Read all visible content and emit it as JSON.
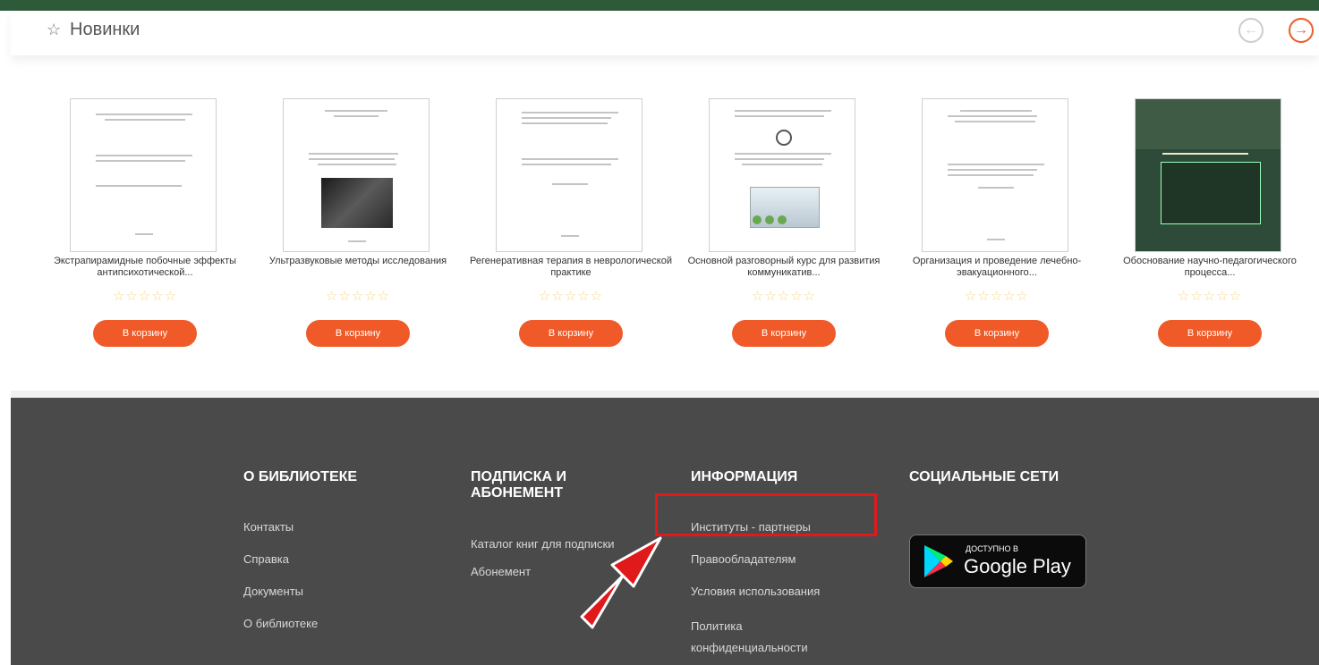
{
  "news": {
    "title": "Новинки",
    "star_icon": "☆",
    "prev_icon": "←",
    "next_icon": "→"
  },
  "books": [
    {
      "title": "Экстрапирамидные побочные эффекты антипсихотической...",
      "stars": "☆☆☆☆☆",
      "cart_label": "В корзину"
    },
    {
      "title": "Ультразвуковые методы исследования",
      "stars": "☆☆☆☆☆",
      "cart_label": "В корзину"
    },
    {
      "title": "Регенеративная терапия в неврологической практике",
      "stars": "☆☆☆☆☆",
      "cart_label": "В корзину"
    },
    {
      "title": "Основной разговорный курс для развития коммуникатив...",
      "stars": "☆☆☆☆☆",
      "cart_label": "В корзину"
    },
    {
      "title": "Организация и проведение лечебно-эвакуационного...",
      "stars": "☆☆☆☆☆",
      "cart_label": "В корзину"
    },
    {
      "title": "Обоснование научно-педагогического процесса...",
      "stars": "☆☆☆☆☆",
      "cart_label": "В корзину"
    }
  ],
  "footer": {
    "about": {
      "heading": "О БИБЛИОТЕКЕ",
      "links": [
        "Контакты",
        "Справка",
        "Документы",
        "О библиотеке"
      ]
    },
    "subscription": {
      "heading": "ПОДПИСКА И АБОНЕМЕНТ",
      "links": [
        "Каталог книг для подписки",
        "Абонемент"
      ]
    },
    "info": {
      "heading": "ИНФОРМАЦИЯ",
      "links": [
        "Институты - партнеры",
        "Правообладателям",
        "Условия использования",
        "Политика конфиденциальности"
      ]
    },
    "social": {
      "heading": "СОЦИАЛЬНЫЕ СЕТИ",
      "google_play_small": "ДОСТУПНО В",
      "google_play_big": "Google Play"
    }
  },
  "colors": {
    "accent": "#f05a28",
    "footer_bg": "#4a4a4a",
    "highlight": "#e0191b",
    "top_band": "#2f5a3a"
  }
}
